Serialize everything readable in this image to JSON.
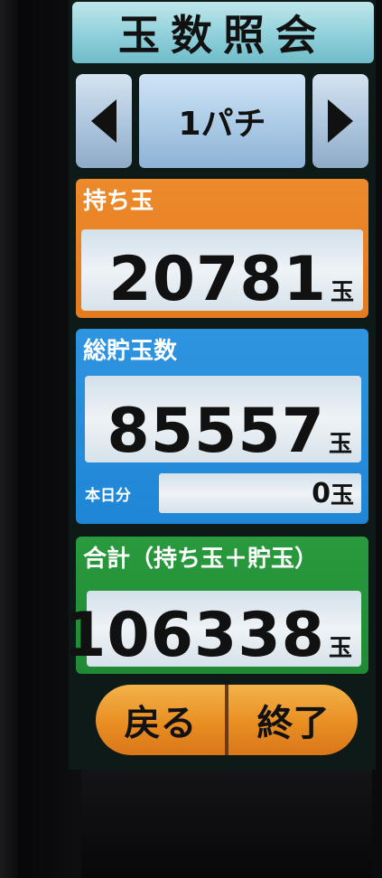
{
  "title": "玉数照会",
  "selector": {
    "value": "1パチ",
    "prev_icon": "triangle-left-icon",
    "next_icon": "triangle-right-icon"
  },
  "held_balls": {
    "label": "持ち玉",
    "value": "20781",
    "unit": "玉",
    "color": "#e47b1e"
  },
  "total_stored": {
    "label": "総貯玉数",
    "value": "85557",
    "unit": "玉",
    "color": "#1f86d6",
    "today": {
      "label": "本日分",
      "value": "0",
      "unit": "玉"
    }
  },
  "sum": {
    "label": "合計（持ち玉＋貯玉）",
    "value": "106338",
    "unit": "玉",
    "color": "#1f8a33"
  },
  "buttons": {
    "back_label": "戻る",
    "end_label": "終了",
    "color": "#e98e22"
  }
}
